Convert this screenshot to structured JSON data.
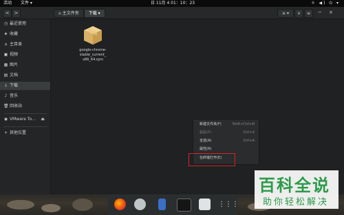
{
  "topbar": {
    "activities": "活动",
    "app_menu": "文件 ▾",
    "clock": "日 11月 4 01：10：23",
    "tray": "⛗ ◀) ⏻ ▾"
  },
  "header": {
    "back": "<",
    "forward": ">",
    "breadcrumbs": [
      "⌂ 主文件夹",
      "下载 ▾"
    ],
    "right_buttons": [
      "≡ ▾",
      "∨",
      "≡",
      "−",
      "×"
    ]
  },
  "sidebar": {
    "items": [
      {
        "icon": "◷",
        "label": "最近使用"
      },
      {
        "icon": "★",
        "label": "收藏"
      },
      {
        "icon": "⌂",
        "label": "主目录"
      },
      {
        "icon": "▣",
        "label": "视频"
      },
      {
        "icon": "▦",
        "label": "图片"
      },
      {
        "icon": "▤",
        "label": "文档"
      },
      {
        "icon": "↓",
        "label": "下载"
      },
      {
        "icon": "♪",
        "label": "音乐"
      },
      {
        "icon": "🗑",
        "label": "回收站"
      },
      {
        "icon": "◉",
        "label": "VMware To...",
        "eject": "⏏"
      },
      {
        "icon": "+",
        "label": "其他位置"
      }
    ]
  },
  "file": {
    "name_lines": [
      "google-chrome-",
      "stable_current_",
      "x86_64.rpm"
    ]
  },
  "context_menu": {
    "items": [
      {
        "label": "新建文件夹(F)",
        "shortcut": "Shift+Ctrl+N",
        "disabled": false
      },
      {
        "label": "粘贴(P)",
        "shortcut": "Ctrl+V",
        "disabled": true
      },
      {
        "label": "全选(A)",
        "shortcut": "Ctrl+A",
        "disabled": false
      },
      {
        "label": "属性(R)",
        "shortcut": "",
        "disabled": false
      },
      {
        "label": "在终端打开(E)",
        "shortcut": "",
        "disabled": false
      }
    ]
  },
  "watermark": {
    "title": "百科全说",
    "subtitle": "助你轻松解决"
  }
}
